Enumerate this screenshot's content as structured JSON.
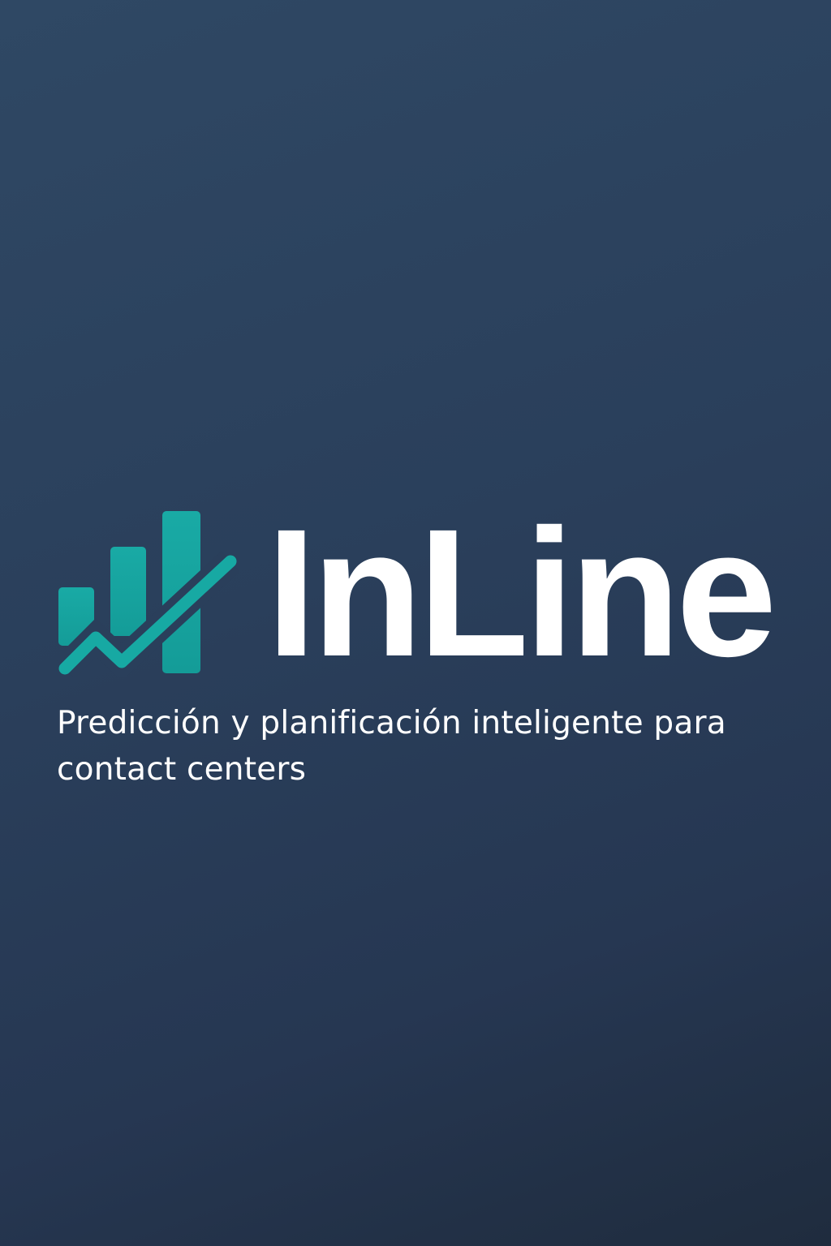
{
  "brand": {
    "name": "InLine",
    "logo_icon": "rising-bar-chart-checkmark-logo",
    "accent_color": "#17a9a3"
  },
  "tagline": "Predicción y planificación inteligente para contact centers",
  "colors": {
    "background_top": "#2f4864",
    "background_bottom": "#1f2c3e",
    "text": "#ffffff"
  }
}
